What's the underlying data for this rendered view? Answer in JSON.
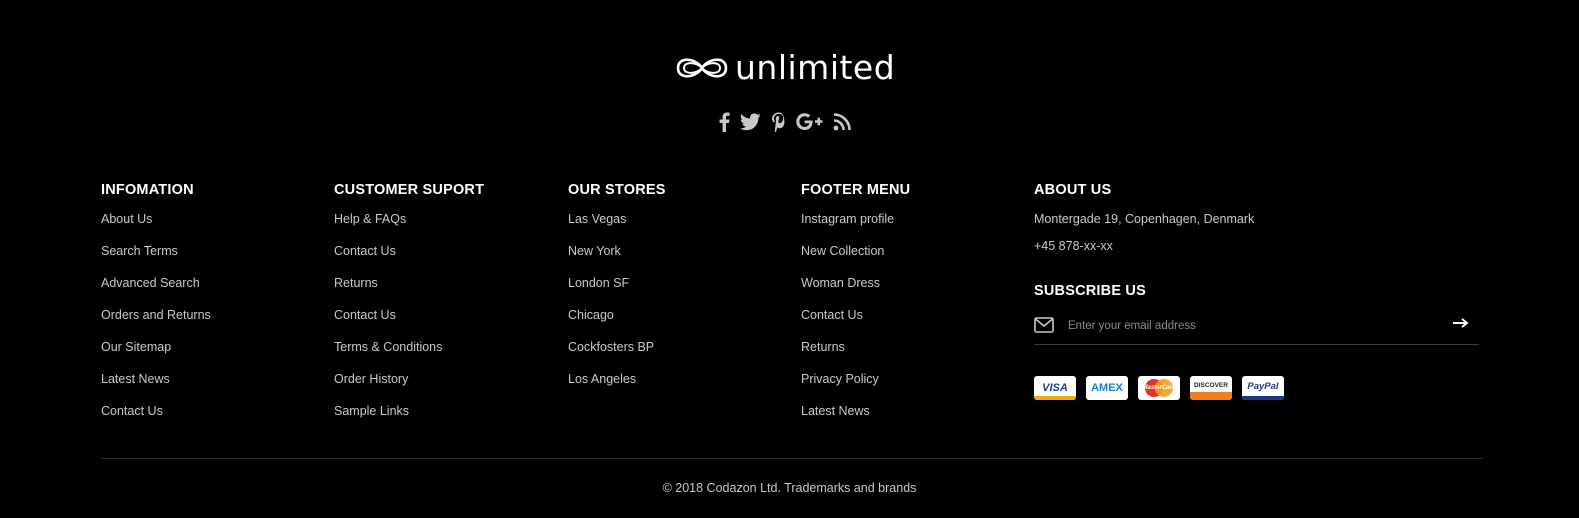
{
  "brand": {
    "logo_text": "unlimited"
  },
  "social": [
    "facebook-icon",
    "twitter-icon",
    "pinterest-icon",
    "google-plus-icon",
    "rss-icon"
  ],
  "columns": [
    {
      "title": "INFOMATION",
      "links": [
        "About Us",
        "Search Terms",
        "Advanced Search",
        "Orders and Returns",
        "Our Sitemap",
        "Latest News",
        "Contact Us"
      ]
    },
    {
      "title": "CUSTOMER SUPORT",
      "links": [
        "Help & FAQs",
        "Contact Us",
        "Returns",
        "Contact Us",
        "Terms & Conditions",
        "Order History",
        "Sample Links"
      ]
    },
    {
      "title": "OUR STORES",
      "links": [
        "Las Vegas",
        "New York",
        "London SF",
        "Chicago",
        "Cockfosters BP",
        "Los Angeles"
      ]
    },
    {
      "title": "FOOTER MENU",
      "links": [
        "Instagram profile",
        "New Collection",
        "Woman Dress",
        "Contact Us",
        "Returns",
        "Privacy Policy",
        "Latest News"
      ]
    }
  ],
  "about": {
    "title": "ABOUT US",
    "address": "Montergade 19, Copenhagen, Denmark",
    "phone": "+45 878-xx-xx"
  },
  "subscribe": {
    "title": "SUBSCRIBE US",
    "placeholder": "Enter your email address"
  },
  "payments": {
    "visa": "VISA",
    "amex": "AMEX",
    "mastercard": "MasterCard",
    "discover": "DISCOVER",
    "paypal": "PayPal"
  },
  "copyright": "© 2018 Codazon Ltd. Trademarks and brands",
  "colors": {
    "background": "#000000",
    "heading": "#ffffff",
    "text": "#c8c8c8",
    "divider": "#2e2e2e"
  }
}
